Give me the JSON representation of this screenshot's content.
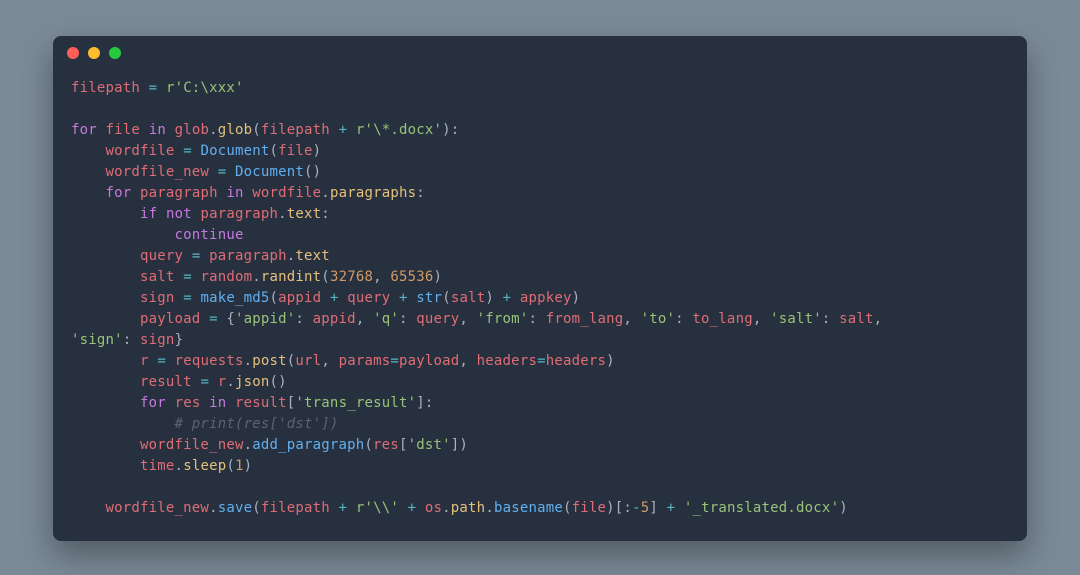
{
  "window": {
    "buttons": [
      "close",
      "minimize",
      "zoom"
    ]
  },
  "code": {
    "language": "python",
    "lines": [
      [
        {
          "c": "id",
          "t": "filepath"
        },
        {
          "c": "pn",
          "t": " "
        },
        {
          "c": "op",
          "t": "="
        },
        {
          "c": "pn",
          "t": " "
        },
        {
          "c": "str",
          "t": "r'C:\\xxx'"
        }
      ],
      [],
      [
        {
          "c": "kw",
          "t": "for"
        },
        {
          "c": "pn",
          "t": " "
        },
        {
          "c": "id",
          "t": "file"
        },
        {
          "c": "pn",
          "t": " "
        },
        {
          "c": "kw",
          "t": "in"
        },
        {
          "c": "pn",
          "t": " "
        },
        {
          "c": "id",
          "t": "glob"
        },
        {
          "c": "pn",
          "t": "."
        },
        {
          "c": "attr",
          "t": "glob"
        },
        {
          "c": "pn",
          "t": "("
        },
        {
          "c": "id",
          "t": "filepath"
        },
        {
          "c": "pn",
          "t": " "
        },
        {
          "c": "op",
          "t": "+"
        },
        {
          "c": "pn",
          "t": " "
        },
        {
          "c": "str",
          "t": "r'\\*.docx'"
        },
        {
          "c": "pn",
          "t": "):"
        }
      ],
      [
        {
          "c": "pn",
          "t": "    "
        },
        {
          "c": "id",
          "t": "wordfile"
        },
        {
          "c": "pn",
          "t": " "
        },
        {
          "c": "op",
          "t": "="
        },
        {
          "c": "pn",
          "t": " "
        },
        {
          "c": "fn",
          "t": "Document"
        },
        {
          "c": "pn",
          "t": "("
        },
        {
          "c": "id",
          "t": "file"
        },
        {
          "c": "pn",
          "t": ")"
        }
      ],
      [
        {
          "c": "pn",
          "t": "    "
        },
        {
          "c": "id",
          "t": "wordfile_new"
        },
        {
          "c": "pn",
          "t": " "
        },
        {
          "c": "op",
          "t": "="
        },
        {
          "c": "pn",
          "t": " "
        },
        {
          "c": "fn",
          "t": "Document"
        },
        {
          "c": "pn",
          "t": "()"
        }
      ],
      [
        {
          "c": "pn",
          "t": "    "
        },
        {
          "c": "kw",
          "t": "for"
        },
        {
          "c": "pn",
          "t": " "
        },
        {
          "c": "id",
          "t": "paragraph"
        },
        {
          "c": "pn",
          "t": " "
        },
        {
          "c": "kw",
          "t": "in"
        },
        {
          "c": "pn",
          "t": " "
        },
        {
          "c": "id",
          "t": "wordfile"
        },
        {
          "c": "pn",
          "t": "."
        },
        {
          "c": "attr",
          "t": "paragraphs"
        },
        {
          "c": "pn",
          "t": ":"
        }
      ],
      [
        {
          "c": "pn",
          "t": "        "
        },
        {
          "c": "kw",
          "t": "if"
        },
        {
          "c": "pn",
          "t": " "
        },
        {
          "c": "kw",
          "t": "not"
        },
        {
          "c": "pn",
          "t": " "
        },
        {
          "c": "id",
          "t": "paragraph"
        },
        {
          "c": "pn",
          "t": "."
        },
        {
          "c": "attr",
          "t": "text"
        },
        {
          "c": "pn",
          "t": ":"
        }
      ],
      [
        {
          "c": "pn",
          "t": "            "
        },
        {
          "c": "kw",
          "t": "continue"
        }
      ],
      [
        {
          "c": "pn",
          "t": "        "
        },
        {
          "c": "id",
          "t": "query"
        },
        {
          "c": "pn",
          "t": " "
        },
        {
          "c": "op",
          "t": "="
        },
        {
          "c": "pn",
          "t": " "
        },
        {
          "c": "id",
          "t": "paragraph"
        },
        {
          "c": "pn",
          "t": "."
        },
        {
          "c": "attr",
          "t": "text"
        }
      ],
      [
        {
          "c": "pn",
          "t": "        "
        },
        {
          "c": "id",
          "t": "salt"
        },
        {
          "c": "pn",
          "t": " "
        },
        {
          "c": "op",
          "t": "="
        },
        {
          "c": "pn",
          "t": " "
        },
        {
          "c": "id",
          "t": "random"
        },
        {
          "c": "pn",
          "t": "."
        },
        {
          "c": "attr",
          "t": "randint"
        },
        {
          "c": "pn",
          "t": "("
        },
        {
          "c": "num",
          "t": "32768"
        },
        {
          "c": "pn",
          "t": ", "
        },
        {
          "c": "num",
          "t": "65536"
        },
        {
          "c": "pn",
          "t": ")"
        }
      ],
      [
        {
          "c": "pn",
          "t": "        "
        },
        {
          "c": "id",
          "t": "sign"
        },
        {
          "c": "pn",
          "t": " "
        },
        {
          "c": "op",
          "t": "="
        },
        {
          "c": "pn",
          "t": " "
        },
        {
          "c": "fn",
          "t": "make_md5"
        },
        {
          "c": "pn",
          "t": "("
        },
        {
          "c": "id",
          "t": "appid"
        },
        {
          "c": "pn",
          "t": " "
        },
        {
          "c": "op",
          "t": "+"
        },
        {
          "c": "pn",
          "t": " "
        },
        {
          "c": "id",
          "t": "query"
        },
        {
          "c": "pn",
          "t": " "
        },
        {
          "c": "op",
          "t": "+"
        },
        {
          "c": "pn",
          "t": " "
        },
        {
          "c": "fn",
          "t": "str"
        },
        {
          "c": "pn",
          "t": "("
        },
        {
          "c": "id",
          "t": "salt"
        },
        {
          "c": "pn",
          "t": ") "
        },
        {
          "c": "op",
          "t": "+"
        },
        {
          "c": "pn",
          "t": " "
        },
        {
          "c": "id",
          "t": "appkey"
        },
        {
          "c": "pn",
          "t": ")"
        }
      ],
      [
        {
          "c": "pn",
          "t": "        "
        },
        {
          "c": "id",
          "t": "payload"
        },
        {
          "c": "pn",
          "t": " "
        },
        {
          "c": "op",
          "t": "="
        },
        {
          "c": "pn",
          "t": " {"
        },
        {
          "c": "str",
          "t": "'appid'"
        },
        {
          "c": "pn",
          "t": ": "
        },
        {
          "c": "id",
          "t": "appid"
        },
        {
          "c": "pn",
          "t": ", "
        },
        {
          "c": "str",
          "t": "'q'"
        },
        {
          "c": "pn",
          "t": ": "
        },
        {
          "c": "id",
          "t": "query"
        },
        {
          "c": "pn",
          "t": ", "
        },
        {
          "c": "str",
          "t": "'from'"
        },
        {
          "c": "pn",
          "t": ": "
        },
        {
          "c": "id",
          "t": "from_lang"
        },
        {
          "c": "pn",
          "t": ", "
        },
        {
          "c": "str",
          "t": "'to'"
        },
        {
          "c": "pn",
          "t": ": "
        },
        {
          "c": "id",
          "t": "to_lang"
        },
        {
          "c": "pn",
          "t": ", "
        },
        {
          "c": "str",
          "t": "'salt'"
        },
        {
          "c": "pn",
          "t": ": "
        },
        {
          "c": "id",
          "t": "salt"
        },
        {
          "c": "pn",
          "t": ", "
        }
      ],
      [
        {
          "c": "str",
          "t": "'sign'"
        },
        {
          "c": "pn",
          "t": ": "
        },
        {
          "c": "id",
          "t": "sign"
        },
        {
          "c": "pn",
          "t": "}"
        }
      ],
      [
        {
          "c": "pn",
          "t": "        "
        },
        {
          "c": "id",
          "t": "r"
        },
        {
          "c": "pn",
          "t": " "
        },
        {
          "c": "op",
          "t": "="
        },
        {
          "c": "pn",
          "t": " "
        },
        {
          "c": "id",
          "t": "requests"
        },
        {
          "c": "pn",
          "t": "."
        },
        {
          "c": "attr",
          "t": "post"
        },
        {
          "c": "pn",
          "t": "("
        },
        {
          "c": "id",
          "t": "url"
        },
        {
          "c": "pn",
          "t": ", "
        },
        {
          "c": "id",
          "t": "params"
        },
        {
          "c": "op",
          "t": "="
        },
        {
          "c": "id",
          "t": "payload"
        },
        {
          "c": "pn",
          "t": ", "
        },
        {
          "c": "id",
          "t": "headers"
        },
        {
          "c": "op",
          "t": "="
        },
        {
          "c": "id",
          "t": "headers"
        },
        {
          "c": "pn",
          "t": ")"
        }
      ],
      [
        {
          "c": "pn",
          "t": "        "
        },
        {
          "c": "id",
          "t": "result"
        },
        {
          "c": "pn",
          "t": " "
        },
        {
          "c": "op",
          "t": "="
        },
        {
          "c": "pn",
          "t": " "
        },
        {
          "c": "id",
          "t": "r"
        },
        {
          "c": "pn",
          "t": "."
        },
        {
          "c": "attr",
          "t": "json"
        },
        {
          "c": "pn",
          "t": "()"
        }
      ],
      [
        {
          "c": "pn",
          "t": "        "
        },
        {
          "c": "kw",
          "t": "for"
        },
        {
          "c": "pn",
          "t": " "
        },
        {
          "c": "id",
          "t": "res"
        },
        {
          "c": "pn",
          "t": " "
        },
        {
          "c": "kw",
          "t": "in"
        },
        {
          "c": "pn",
          "t": " "
        },
        {
          "c": "id",
          "t": "result"
        },
        {
          "c": "pn",
          "t": "["
        },
        {
          "c": "str",
          "t": "'trans_result'"
        },
        {
          "c": "pn",
          "t": "]:"
        }
      ],
      [
        {
          "c": "pn",
          "t": "            "
        },
        {
          "c": "cmt",
          "t": "# print(res['dst'])"
        }
      ],
      [
        {
          "c": "pn",
          "t": "        "
        },
        {
          "c": "id",
          "t": "wordfile_new"
        },
        {
          "c": "pn",
          "t": "."
        },
        {
          "c": "fn",
          "t": "add_paragraph"
        },
        {
          "c": "pn",
          "t": "("
        },
        {
          "c": "id",
          "t": "res"
        },
        {
          "c": "pn",
          "t": "["
        },
        {
          "c": "str",
          "t": "'dst'"
        },
        {
          "c": "pn",
          "t": "])"
        }
      ],
      [
        {
          "c": "pn",
          "t": "        "
        },
        {
          "c": "id",
          "t": "time"
        },
        {
          "c": "pn",
          "t": "."
        },
        {
          "c": "attr",
          "t": "sleep"
        },
        {
          "c": "pn",
          "t": "("
        },
        {
          "c": "num",
          "t": "1"
        },
        {
          "c": "pn",
          "t": ")"
        }
      ],
      [],
      [
        {
          "c": "pn",
          "t": "    "
        },
        {
          "c": "id",
          "t": "wordfile_new"
        },
        {
          "c": "pn",
          "t": "."
        },
        {
          "c": "fn",
          "t": "save"
        },
        {
          "c": "pn",
          "t": "("
        },
        {
          "c": "id",
          "t": "filepath"
        },
        {
          "c": "pn",
          "t": " "
        },
        {
          "c": "op",
          "t": "+"
        },
        {
          "c": "pn",
          "t": " "
        },
        {
          "c": "str",
          "t": "r'\\\\'"
        },
        {
          "c": "pn",
          "t": " "
        },
        {
          "c": "op",
          "t": "+"
        },
        {
          "c": "pn",
          "t": " "
        },
        {
          "c": "id",
          "t": "os"
        },
        {
          "c": "pn",
          "t": "."
        },
        {
          "c": "attr",
          "t": "path"
        },
        {
          "c": "pn",
          "t": "."
        },
        {
          "c": "fn",
          "t": "basename"
        },
        {
          "c": "pn",
          "t": "("
        },
        {
          "c": "id",
          "t": "file"
        },
        {
          "c": "pn",
          "t": ")["
        },
        {
          "c": "pn",
          "t": ":"
        },
        {
          "c": "op",
          "t": "-"
        },
        {
          "c": "num",
          "t": "5"
        },
        {
          "c": "pn",
          "t": "] "
        },
        {
          "c": "op",
          "t": "+"
        },
        {
          "c": "pn",
          "t": " "
        },
        {
          "c": "str",
          "t": "'_translated.docx'"
        },
        {
          "c": "pn",
          "t": ")"
        }
      ]
    ]
  }
}
